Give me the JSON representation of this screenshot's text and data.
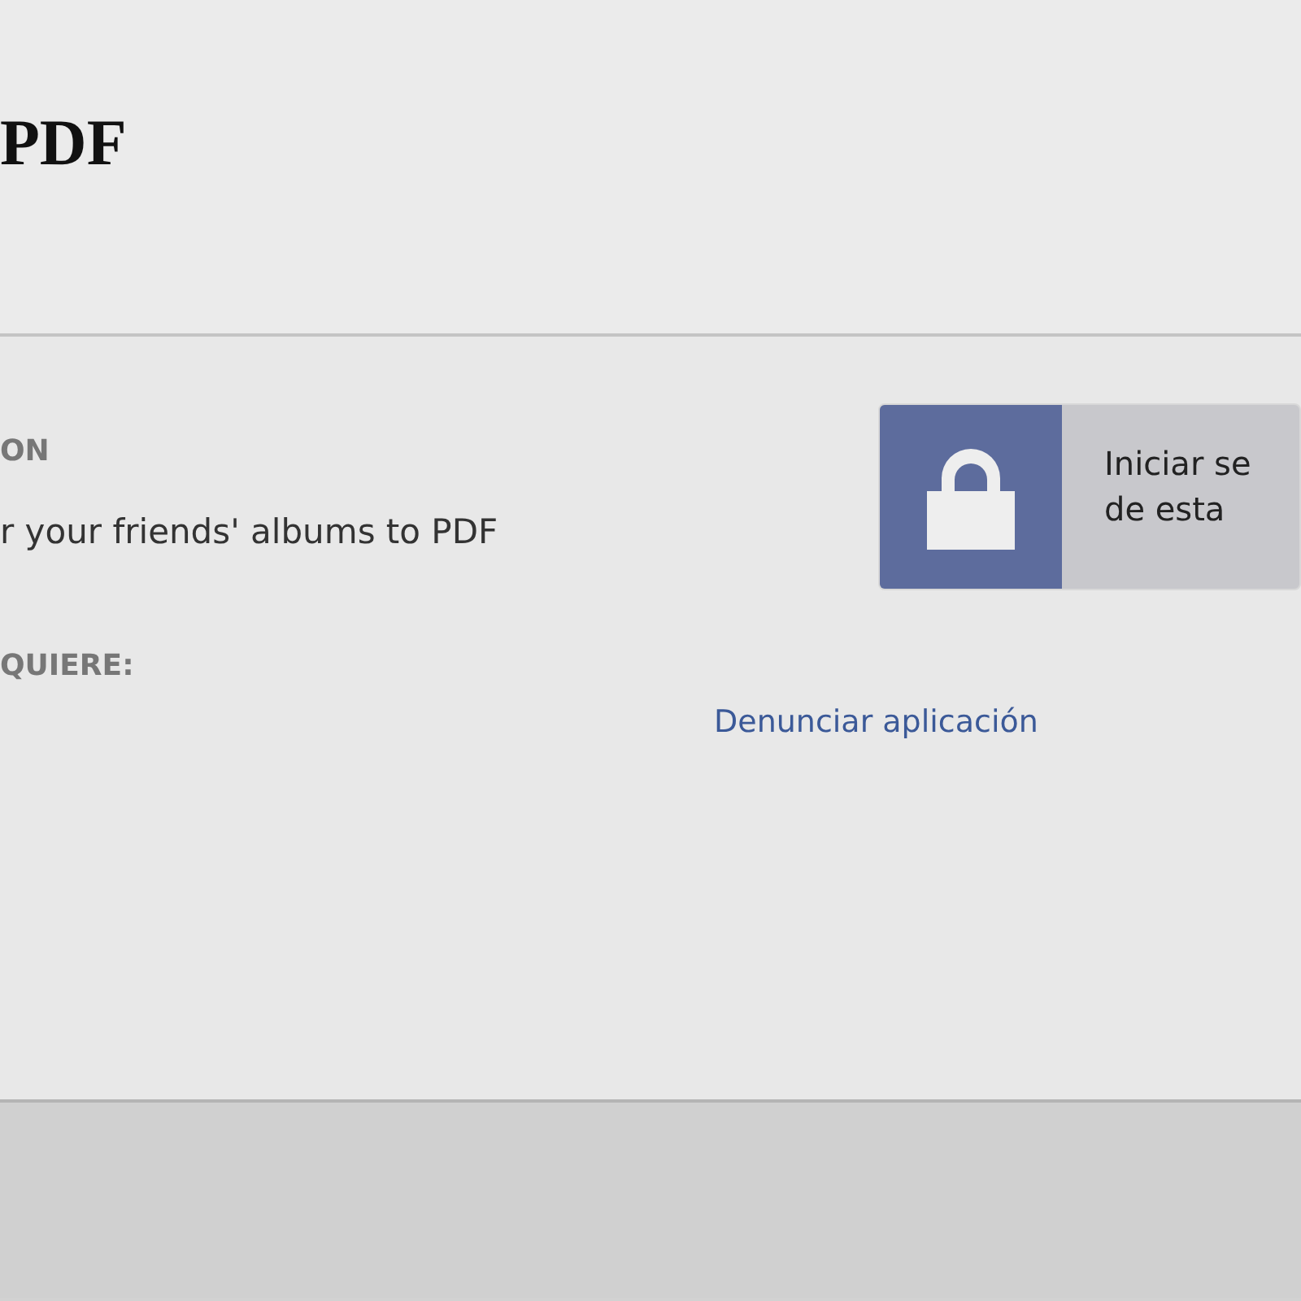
{
  "header": {
    "title": "PDF"
  },
  "app": {
    "section_label": "ON",
    "description": "r your friends' albums to PDF",
    "requires_label": "QUIERE:"
  },
  "login": {
    "lines": [
      "Iniciar se",
      "de esta"
    ]
  },
  "report_link": "Denunciar aplicación"
}
